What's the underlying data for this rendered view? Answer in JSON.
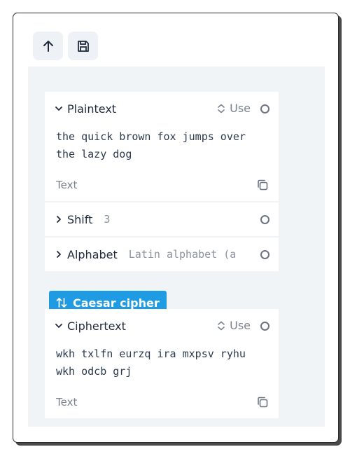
{
  "toolbar": {
    "buttons": [
      {
        "icon": "arrow-up-icon"
      },
      {
        "icon": "save-icon"
      }
    ]
  },
  "plaintext": {
    "label": "Plaintext",
    "use_label": "Use",
    "value": "the quick brown fox jumps over the lazy dog",
    "type_label": "Text"
  },
  "shift": {
    "label": "Shift",
    "value": "3"
  },
  "alphabet": {
    "label": "Alphabet",
    "value": "Latin alphabet (a"
  },
  "operation": {
    "label": "Caesar cipher",
    "color": "#1e9be3"
  },
  "ciphertext": {
    "label": "Ciphertext",
    "use_label": "Use",
    "value": "wkh txlfn eurzq ira mxpsv ryhu wkh odcb grj",
    "type_label": "Text"
  }
}
